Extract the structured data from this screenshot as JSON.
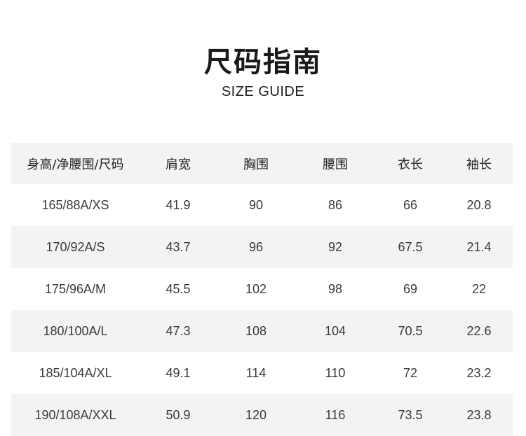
{
  "title": "尺码指南",
  "subtitle": "SIZE GUIDE",
  "table": {
    "headers": [
      "身高/净腰围/尺码",
      "肩宽",
      "胸围",
      "腰围",
      "衣长",
      "袖长"
    ],
    "rows": [
      [
        "165/88A/XS",
        "41.9",
        "90",
        "86",
        "66",
        "20.8"
      ],
      [
        "170/92A/S",
        "43.7",
        "96",
        "92",
        "67.5",
        "21.4"
      ],
      [
        "175/96A/M",
        "45.5",
        "102",
        "98",
        "69",
        "22"
      ],
      [
        "180/100A/L",
        "47.3",
        "108",
        "104",
        "70.5",
        "22.6"
      ],
      [
        "185/104A/XL",
        "49.1",
        "114",
        "110",
        "72",
        "23.2"
      ],
      [
        "190/108A/XXL",
        "50.9",
        "120",
        "116",
        "73.5",
        "23.8"
      ]
    ]
  },
  "colors": {
    "stripe": "#f4f3f1",
    "text": "#222222"
  }
}
